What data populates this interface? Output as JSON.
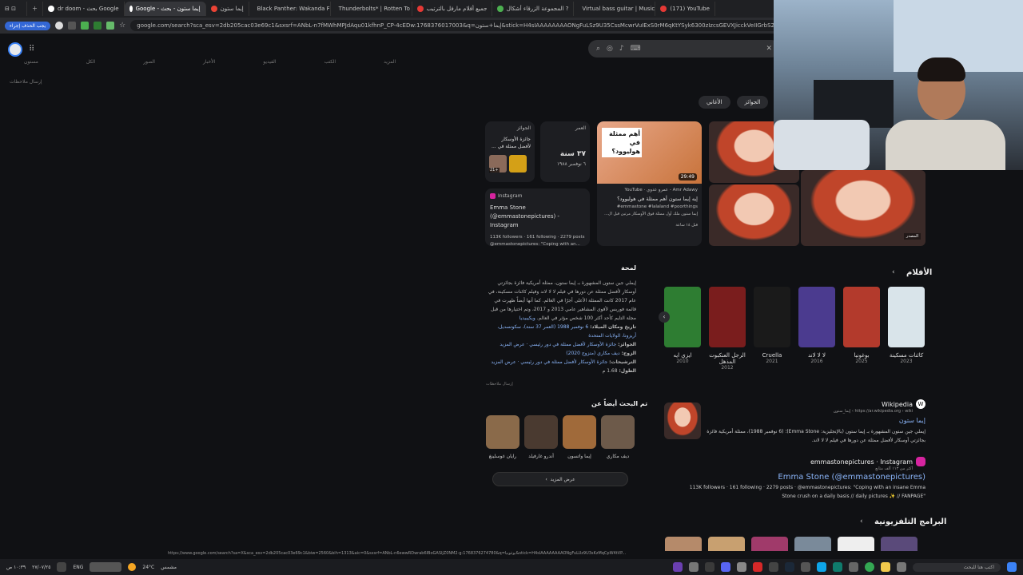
{
  "tabs": [
    {
      "label": "dr doom - بحث Google",
      "color": "#ffffff"
    },
    {
      "label": "Google - إيما ستون - بحث",
      "color": "#ffffff",
      "active": true
    },
    {
      "label": "إيما ستون",
      "color": "#ea4335"
    },
    {
      "label": "Black Panther: Wakanda F",
      "color": "#e53935"
    },
    {
      "label": "Thunderbolts* | Rotten To",
      "color": "#e53935"
    },
    {
      "label": "جميع أفلام مارفل بالترتيب",
      "color": "#e53935"
    },
    {
      "label": "المجموعة الزرقاء أشكال ?",
      "color": "#4caf50"
    },
    {
      "label": "Virtual bass guitar | Music",
      "color": "#4caf50"
    },
    {
      "label": "(171) YouTube",
      "color": "#e53935"
    }
  ],
  "toolbar": {
    "profile_button": "يجب الحذف إجراء",
    "url": "google.com/search?sca_esv=2db205cac03e69c1&sxsrf=ANbL-n7fMWhMPJdAqu01kfhnP_CP-4cEDw:1768376017003&q=إيما+ستون&stick=H4sIAAAAAAAAONgFuLSz9U35CssMcwrVuIExS0rM6qKtYSyk6300zIzcsGEVXJicckVeIIGrbS2"
  },
  "nav_links": [
    "مستون",
    "الكل",
    "الصور",
    "الأخبار",
    "الفيديو",
    "الكتب",
    "المزيد"
  ],
  "feedback": "إرسال ملاحظات",
  "chips": [
    "الأغاني",
    "الجوائز"
  ],
  "awards_card": {
    "title": "الجوائز",
    "text": "جائزة الأوسكار لأفضل ممثلة في ...",
    "badge": "21+"
  },
  "age_card": {
    "title": "العمر",
    "value": "٣٧ سنة",
    "date": "٦ نوفمبر ١٩٨٨"
  },
  "instagram_card": {
    "label": "Instagram",
    "name": "Emma Stone (@emmastonepictures) - Instagram",
    "stats": "113K followers · 161 following · 2279 posts",
    "snippet": "@emmastonepictures: \"Coping with an..."
  },
  "video_card": {
    "thumb_text": "أهم ممثلة في هوليوود؟",
    "duration": "29:49",
    "channel": "Amr Adawy - عمرو عدوي · YouTube",
    "title": "إيه إيما ستون أهم ممثلة في هوليوود؟",
    "tags": "emmastone #lalaland #poorthings#",
    "desc": "إيما ستون ملك أول ممثلة فوق الأوسكار مرتين قبل ال...",
    "age": "قبل ١٤ ساعة"
  },
  "image_tag": "المصدر",
  "movies_section": {
    "title": "الأفلام",
    "items": [
      {
        "title": "كائنات مسكينة",
        "year": "2023",
        "color": "#d9e4ea"
      },
      {
        "title": "بوغونيا",
        "year": "2025",
        "color": "#b33a2c"
      },
      {
        "title": "لا لا لاند",
        "year": "2016",
        "color": "#4b3b8f"
      },
      {
        "title": "Cruella",
        "year": "2021",
        "color": "#1a1a1a"
      },
      {
        "title": "الرجل العنكبوت المذهل",
        "year": "2012",
        "color": "#7a1d1d"
      },
      {
        "title": "ايزي ايه",
        "year": "2010",
        "color": "#2e7d32"
      }
    ]
  },
  "about": {
    "title": "لمحة",
    "text": "إيملي جين ستون المشهورة بـ إيما ستون، ممثلة أمريكية فائزة بجائزتي أوسكار لأفضل ممثلة عن دورها في فيلم لا لا لاند وفيلم كائنات مسكينة، في عام 2017 كانت الممثلة الأعلى أجرًا في العالم. كما أنها أيضاً ظهرت في قائمة فوربس لأقوى المشاهير عامي 2013 و 2017، وتم اختيارها من قبل مجلة التايم كأحد أكثر 100 شخص مؤثر في العالم.",
    "link": "ويكيبيديا",
    "born_label": "تاريخ ومكان الميلاد:",
    "born_value": "6 نوفمبر 1988 (العمر 37 سنة)، سكوتسديل، أريزونا، الولايات المتحدة",
    "awards_label": "الجوائز:",
    "awards_value": "جائزة الأوسكار لأفضل ممثلة في دور رئيسي · عرض المزيد",
    "spouse_label": "الزوج:",
    "spouse_value": "ديف مكاري (متزوج 2020)",
    "nominations_label": "الترشيحات:",
    "nominations_value": "جائزة الأوسكار لأفضل ممثلة في دور رئيسي · عرض المزيد",
    "height_label": "الطول:",
    "height_value": "1.68 م",
    "feedback": "إرسال ملاحظات"
  },
  "people_also": {
    "title": "تم البحث أيضاً عن",
    "items": [
      {
        "name": "ديف مكاري",
        "color": "#6d5a4a"
      },
      {
        "name": "إيما واتسون",
        "color": "#a06a3a"
      },
      {
        "name": "أندرو غارفيلد",
        "color": "#4a3a30"
      },
      {
        "name": "رايان غوسلينغ",
        "color": "#8a6a4a"
      }
    ],
    "more": "عرض المزيد"
  },
  "wiki_result": {
    "source": "Wikipedia",
    "url": "https://ar.wikipedia.org › wiki › إيما_ستون",
    "title": "إيما ستون",
    "snippet": "إيملي جين ستون المشهورة بـ إيما ستون (بالإنجليزية: Emma Stone)؛ (6 نوفمبر 1988)، ممثلة أمريكية فائزة بجائزتي أوسكار لأفضل ممثلة عن دورها في فيلم لا لا لاند."
  },
  "insta_result": {
    "source": "emmastonepictures · Instagram",
    "sub": "أكثر من ١١٣ ألف متابع",
    "title": "Emma Stone (@emmastonepictures)",
    "stats": "113K followers · 161 following · 2279 posts · @emmastonepictures: \"Coping with an insane Emma Stone crush on a daily basis // daily pictures ✨ // FANPAGE\""
  },
  "tv_section": {
    "title": "البرامج التلفزيونية"
  },
  "status_url": "https://www.google.com/search?sa=X&sca_esv=2db205cac03e69c1&biw=2560&bih=1313&aic=0&sxsrf=ANbL-n6ewwRDwrab6lBoGASljZ0NM2-g:1768376274780&q=بوغونيا&stick=H4sIAAAAAAAAONgFuLUz9U3sKzMqCpW4tVP...",
  "taskbar": {
    "time": "١٠:٣٩ ص",
    "date": "٢٧/٠٧/٢٥",
    "lang": "ENG",
    "weather": "24°C",
    "weather_label": "مشمس",
    "search": "اكتب هنا للبحث"
  }
}
